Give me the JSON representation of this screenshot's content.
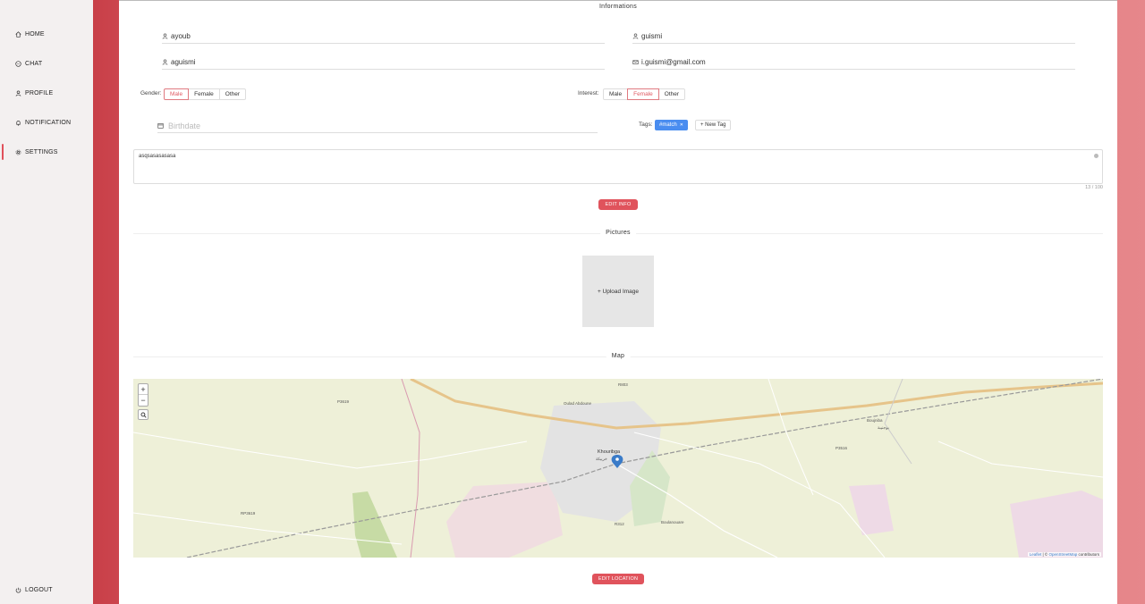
{
  "sidebar": {
    "items": [
      {
        "label": "HOME",
        "icon": "home-icon"
      },
      {
        "label": "CHAT",
        "icon": "chat-icon"
      },
      {
        "label": "PROFILE",
        "icon": "user-icon"
      },
      {
        "label": "NOTIFICATION",
        "icon": "bell-icon"
      },
      {
        "label": "SETTINGS",
        "icon": "gear-icon"
      }
    ],
    "active": "SETTINGS",
    "logout_label": "LOGOUT"
  },
  "info": {
    "title": "Informations",
    "username": "ayoub",
    "first_name": "guismi",
    "last_name": "aguismi",
    "email": "i.guismi@gmail.com",
    "gender_label": "Gender:",
    "gender_options": [
      "Male",
      "Female",
      "Other"
    ],
    "gender_selected": "Male",
    "interest_label": "Interest:",
    "interest_options": [
      "Male",
      "Female",
      "Other"
    ],
    "interest_selected": "Female",
    "birthdate_placeholder": "Birthdate",
    "tags_label": "Tags:",
    "tags": [
      "#match"
    ],
    "new_tag_label": "+ New Tag",
    "bio": "asqsasasasasa",
    "bio_counter": "13 / 100",
    "edit_button": "EDIT INFO"
  },
  "pictures": {
    "title": "Pictures",
    "upload_label": "+ Upload Image"
  },
  "map": {
    "title": "Map",
    "zoom_in": "+",
    "zoom_out": "−",
    "attribution_leaflet": "Leaflet",
    "attribution_sep": " | © ",
    "attribution_osm": "OpenStreetMap",
    "attribution_tail": " contributors",
    "places": {
      "city": "Khouribga",
      "city_ar": "خريبكة",
      "oued": "Oulad Abdoune",
      "bouj": "Boujniba",
      "bouj_ar": "بوجنيبة",
      "boulan": "Boulanouare",
      "rd1": "R803",
      "rd2": "P3619",
      "rd3": "RP3619",
      "rd4": "P3516",
      "rd5": "R312"
    },
    "edit_button": "EDIT LOCATION"
  },
  "colors": {
    "accent": "#e0535c",
    "tag_blue": "#4a8df0"
  }
}
